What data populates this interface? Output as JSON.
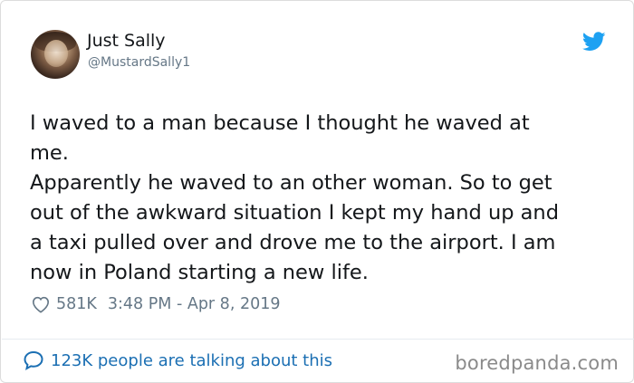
{
  "tweet": {
    "display_name": "Just Sally",
    "handle": "@MustardSally1",
    "lines": [
      "I waved to a man because I thought he waved at",
      "me.",
      "Apparently he waved to an other woman. So to get",
      "out of the awkward situation I kept my hand up and",
      "a taxi pulled over and drove me to the airport. I am",
      "now in Poland starting a new life."
    ],
    "likes": "581K",
    "timestamp": "3:48 PM - Apr 8, 2019",
    "talking": "123K people are talking about this",
    "avatar_icon": "user-avatar",
    "brand_icon": "twitter-bird-icon",
    "like_icon": "heart-outline-icon",
    "talk_icon": "speech-bubble-icon"
  },
  "watermark": "boredpanda.com",
  "colors": {
    "text": "#14171a",
    "secondary": "#657786",
    "twitter_blue": "#1da1f2",
    "link_blue": "#1b6fb3",
    "watermark": "#8a8a8a"
  }
}
